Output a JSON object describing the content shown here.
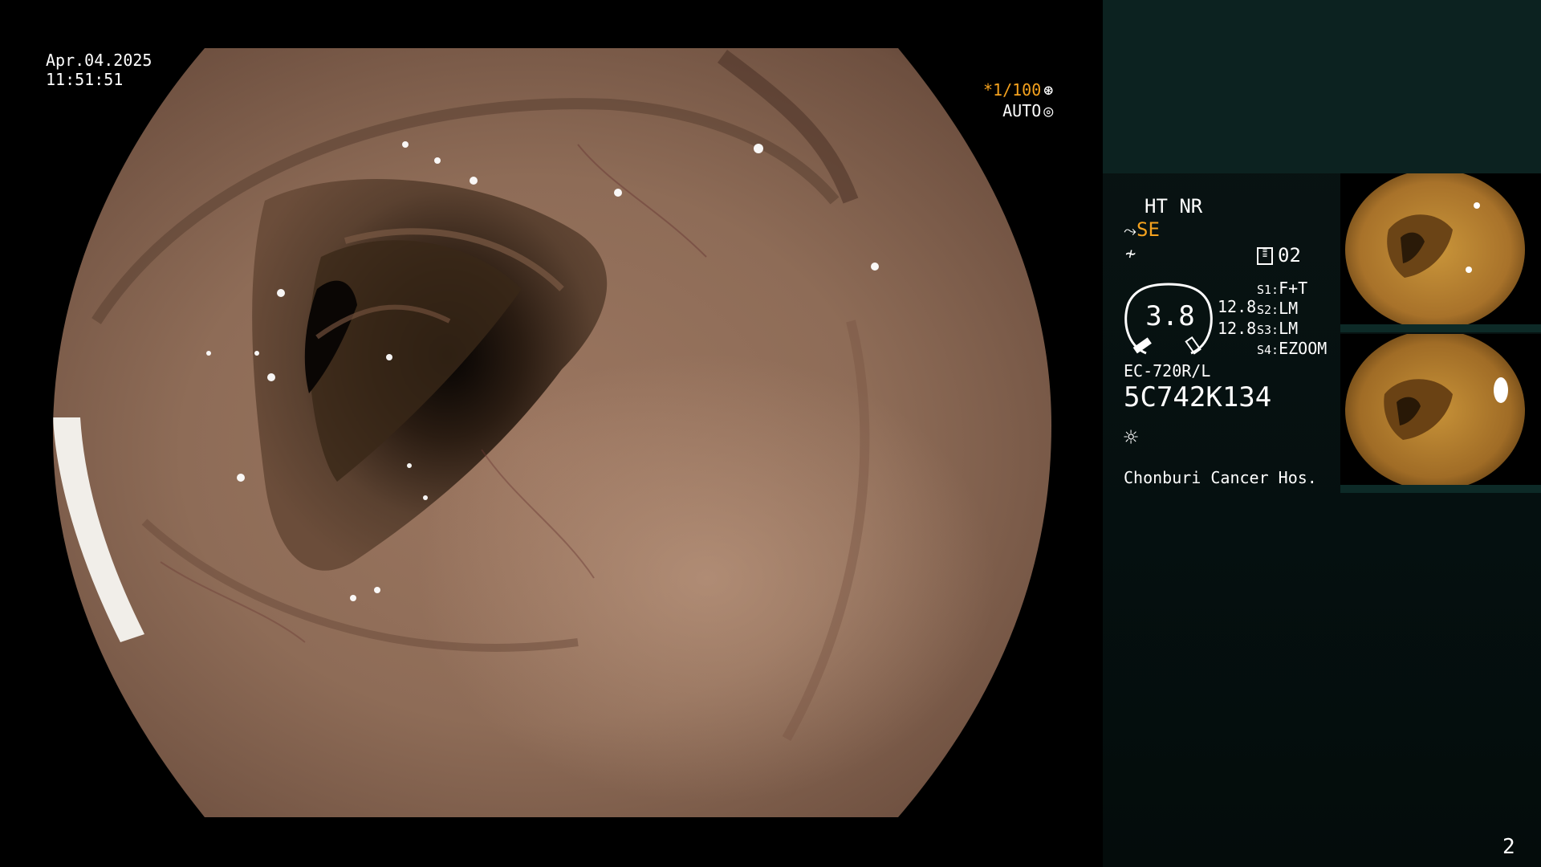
{
  "overlay": {
    "date": "Apr.04.2025",
    "time": "11:51:51",
    "shutter": "*1/100",
    "shutter_icon": "aperture-icon",
    "exposure": "AUTO",
    "exposure_icon": "iris-icon"
  },
  "panel": {
    "enhance": "HT NR",
    "structure_mode": "SE",
    "structure_icon": "structure-enhance-icon",
    "color_icon": "color-mode-icon",
    "channel_icon": "record-icon",
    "channel": "02",
    "zoom": "3.8",
    "level_a": "12.8",
    "level_b": "12.8",
    "switches": [
      {
        "key": "S1:",
        "val": "F+T"
      },
      {
        "key": "S2:",
        "val": "LM"
      },
      {
        "key": "S3:",
        "val": "LM"
      },
      {
        "key": "S4:",
        "val": "EZOOM"
      }
    ],
    "scope_model": "EC-720R/L",
    "serial": "5C742K134",
    "light_icon": "sun-icon",
    "hospital": "Chonburi Cancer Hos.",
    "page_number": "2"
  },
  "colors": {
    "accent": "#f5a21e",
    "panel_top": "#0c2220",
    "panel_bg": "#051010"
  }
}
